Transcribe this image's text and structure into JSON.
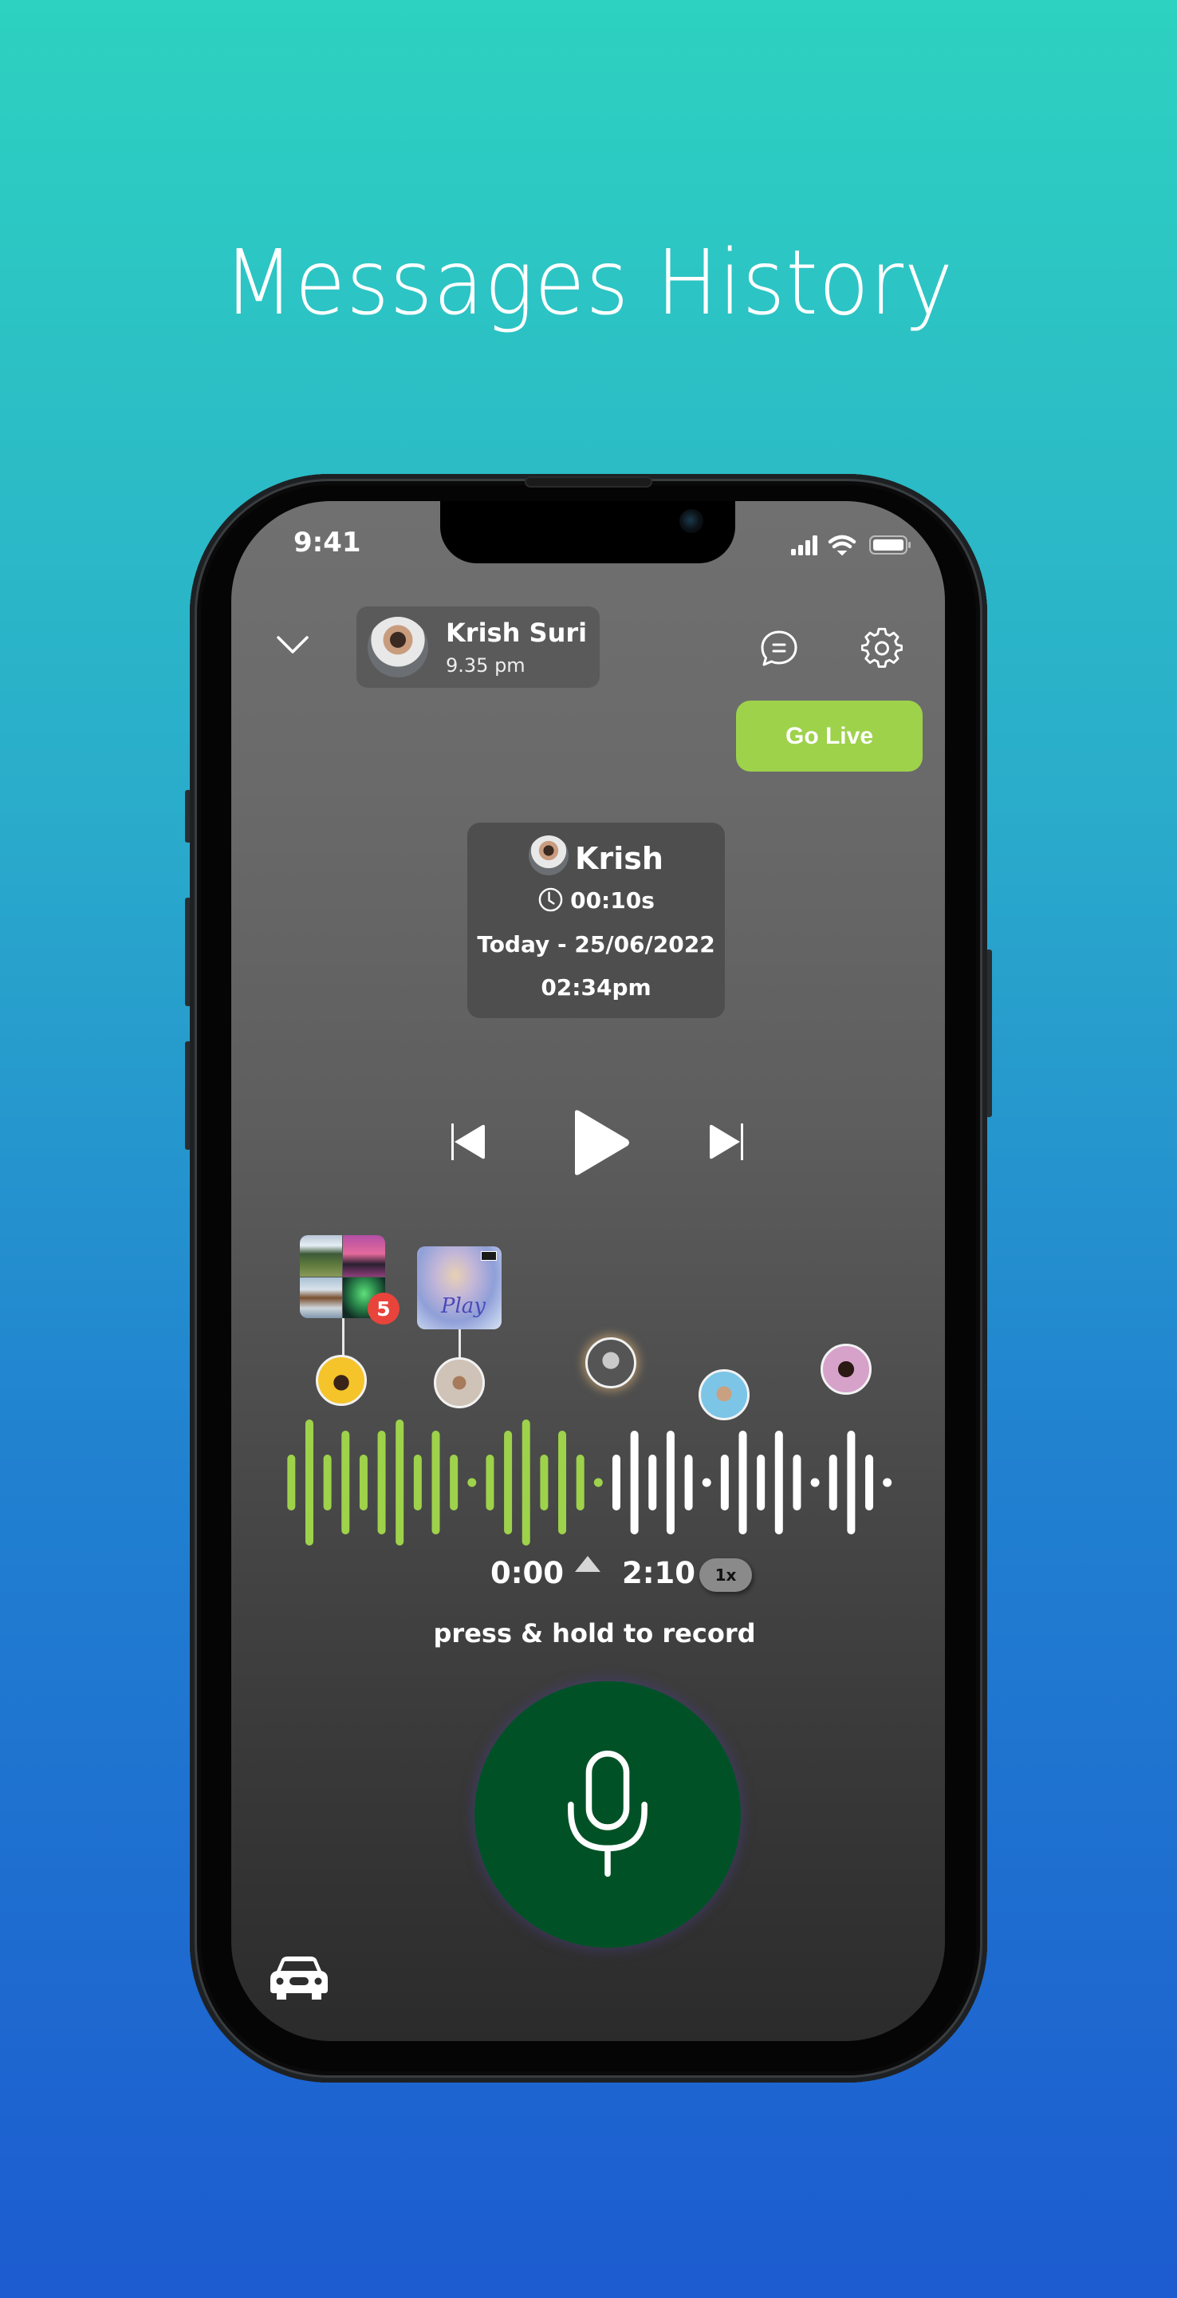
{
  "page": {
    "title": "Messages History"
  },
  "colors": {
    "bg_top": "#2dd2c0",
    "bg_bottom": "#1c5bd0",
    "accent_green": "#9ed24b",
    "mic_green": "#005226",
    "badge_red": "#e8443c",
    "wave_played": "#9ed24b",
    "wave_unplayed": "#ffffff"
  },
  "status_bar": {
    "time": "9:41",
    "icons": [
      "signal-icon",
      "wifi-icon",
      "battery-icon"
    ]
  },
  "header": {
    "collapse_icon": "chevron-down-icon",
    "contact": {
      "name": "Krish Suri",
      "time": "9.35 pm"
    },
    "chat_icon": "chat-bubble-icon",
    "settings_icon": "gear-icon",
    "go_live_label": "Go Live"
  },
  "message_info": {
    "sender": "Krish",
    "duration": "00:10s",
    "date": "Today - 25/06/2022",
    "time": "02:34pm"
  },
  "playback_controls": {
    "previous": "skip-previous-icon",
    "play": "play-icon",
    "next": "skip-next-icon"
  },
  "media": {
    "gallery": {
      "count_badge": "5",
      "images": [
        "mountain-lake",
        "pink-sunset",
        "lake-reflection",
        "aurora"
      ]
    },
    "album": {
      "title": "Play"
    }
  },
  "participants": [
    {
      "name": "participant-1",
      "bg": "#f5c42b",
      "attached": "gallery"
    },
    {
      "name": "participant-2",
      "bg": "#cfc2b6",
      "attached": "album"
    },
    {
      "name": "participant-3",
      "bg": "#8a8a8a",
      "highlighted": true
    },
    {
      "name": "participant-4",
      "bg": "#7cc5e6"
    },
    {
      "name": "participant-5",
      "bg": "#d6a2c9"
    }
  ],
  "waveform": {
    "bars": [
      2,
      4,
      2,
      3,
      2,
      3,
      4,
      2,
      3,
      2,
      1,
      2,
      3,
      4,
      2,
      3,
      2,
      1,
      2,
      3,
      2,
      3,
      2,
      1,
      2,
      3,
      2,
      3,
      2,
      1,
      2,
      3,
      2,
      1
    ],
    "played_count": 18,
    "progress": 0.5
  },
  "player": {
    "current_time": "0:00",
    "total_time": "2:10",
    "speed": "1x",
    "record_hint": "press & hold to record"
  },
  "footer": {
    "car_mode_icon": "car-icon"
  }
}
